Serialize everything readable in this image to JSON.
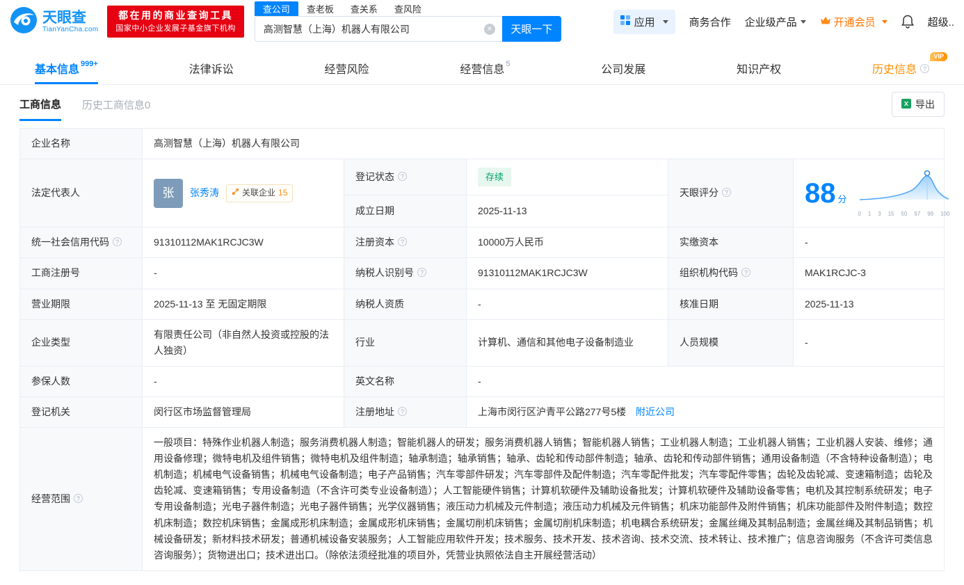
{
  "colors": {
    "brand_blue": "#0084ff",
    "promo_red": "#e60012",
    "vip_orange": "#ff8000",
    "history_orange": "#ff9000",
    "status_green": "#00a265"
  },
  "header": {
    "logo": {
      "name": "天眼查",
      "domain": "TianYanCha.com"
    },
    "promo": {
      "line1": "都在用的商业查询工具",
      "line2": "国家中小企业发展子基金旗下机构"
    },
    "search_tabs": [
      {
        "label": "查公司"
      },
      {
        "label": "查老板"
      },
      {
        "label": "查关系"
      },
      {
        "label": "查风险"
      }
    ],
    "search": {
      "value": "高测智慧（上海）机器人有限公司",
      "button": "天眼一下"
    },
    "menu": {
      "apps": "应用",
      "cooperation": "商务合作",
      "enterprise": "企业级产品",
      "vip": "开通会员",
      "super": "超级.."
    }
  },
  "nav": {
    "tabs": [
      {
        "label": "基本信息",
        "count": "999+"
      },
      {
        "label": "法律诉讼",
        "count": ""
      },
      {
        "label": "经营风险",
        "count": ""
      },
      {
        "label": "经营信息",
        "count": "5"
      },
      {
        "label": "公司发展",
        "count": ""
      },
      {
        "label": "知识产权",
        "count": ""
      },
      {
        "label": "历史信息",
        "count": "",
        "vip": "VIP"
      }
    ]
  },
  "subnav": {
    "tab_active": "工商信息",
    "tab_history": "历史工商信息",
    "tab_history_count": "0",
    "export": "导出"
  },
  "company": {
    "name_label": "企业名称",
    "name_value": "高测智慧（上海）机器人有限公司",
    "legal_rep_label": "法定代表人",
    "legal_rep_avatar": "张",
    "legal_rep_name": "张秀涛",
    "related_label": "关联企业",
    "related_count": "15",
    "reg_status_label": "登记状态",
    "reg_status_value": "存续",
    "establish_label": "成立日期",
    "establish_value": "2025-11-13",
    "score_label": "天眼评分",
    "credit_code_label": "统一社会信用代码",
    "credit_code_value": "91310112MAK1RCJC3W",
    "reg_capital_label": "注册资本",
    "reg_capital_value": "10000万人民币",
    "paid_capital_label": "实缴资本",
    "paid_capital_value": "-",
    "reg_no_label": "工商注册号",
    "reg_no_value": "-",
    "taxpayer_id_label": "纳税人识别号",
    "taxpayer_id_value": "91310112MAK1RCJC3W",
    "org_code_label": "组织机构代码",
    "org_code_value": "MAK1RCJC-3",
    "term_label": "营业期限",
    "term_value": "2025-11-13 至 无固定期限",
    "taxpayer_quality_label": "纳税人资质",
    "taxpayer_quality_value": "-",
    "approval_label": "核准日期",
    "approval_value": "2025-11-13",
    "type_label": "企业类型",
    "type_value": "有限责任公司（非自然人投资或控股的法人独资）",
    "industry_label": "行业",
    "industry_value": "计算机、通信和其他电子设备制造业",
    "staff_label": "人员规模",
    "staff_value": "-",
    "insured_label": "参保人数",
    "insured_value": "-",
    "en_name_label": "英文名称",
    "en_name_value": "-",
    "authority_label": "登记机关",
    "authority_value": "闵行区市场监督管理局",
    "address_label": "注册地址",
    "address_value": "上海市闵行区沪青平公路277号5楼",
    "address_link": "附近公司",
    "scope_label": "经营范围",
    "scope_value": "一般项目：特殊作业机器人制造；服务消费机器人制造；智能机器人的研发；服务消费机器人销售；智能机器人销售；工业机器人制造；工业机器人销售；工业机器人安装、维修；通用设备修理；微特电机及组件销售；微特电机及组件制造；轴承制造；轴承销售；轴承、齿轮和传动部件制造；轴承、齿轮和传动部件销售；通用设备制造（不含特种设备制造）；电机制造；机械电气设备销售；机械电气设备制造；电子产品销售；汽车零部件研发；汽车零部件及配件制造；汽车零配件批发；汽车零配件零售；齿轮及齿轮减、变速箱制造；齿轮及齿轮减、变速箱销售；专用设备制造（不含许可类专业设备制造）；人工智能硬件销售；计算机软硬件及辅助设备批发；计算机软硬件及辅助设备零售；电机及其控制系统研发；电子专用设备制造；光电子器件制造；光电子器件销售；光学仪器销售；液压动力机械及元件制造；液压动力机械及元件销售；机床功能部件及附件销售；机床功能部件及附件制造；数控机床制造；数控机床销售；金属成形机床制造；金属成形机床销售；金属切削机床销售；金属切削机床制造；机电耦合系统研发；金属丝绳及其制品制造；金属丝绳及其制品销售；机械设备研发；新材料技术研发；普通机械设备安装服务；人工智能应用软件开发；技术服务、技术开发、技术咨询、技术交流、技术转让、技术推广；信息咨询服务（不含许可类信息咨询服务）；货物进出口；技术进出口。（除依法须经批准的项目外，凭营业执照依法自主开展经营活动）"
  },
  "score_chart": {
    "type": "area",
    "score": "88",
    "unit": "分",
    "ticks": [
      "0",
      "1",
      "3",
      "15",
      "50",
      "97",
      "99",
      "100"
    ]
  }
}
